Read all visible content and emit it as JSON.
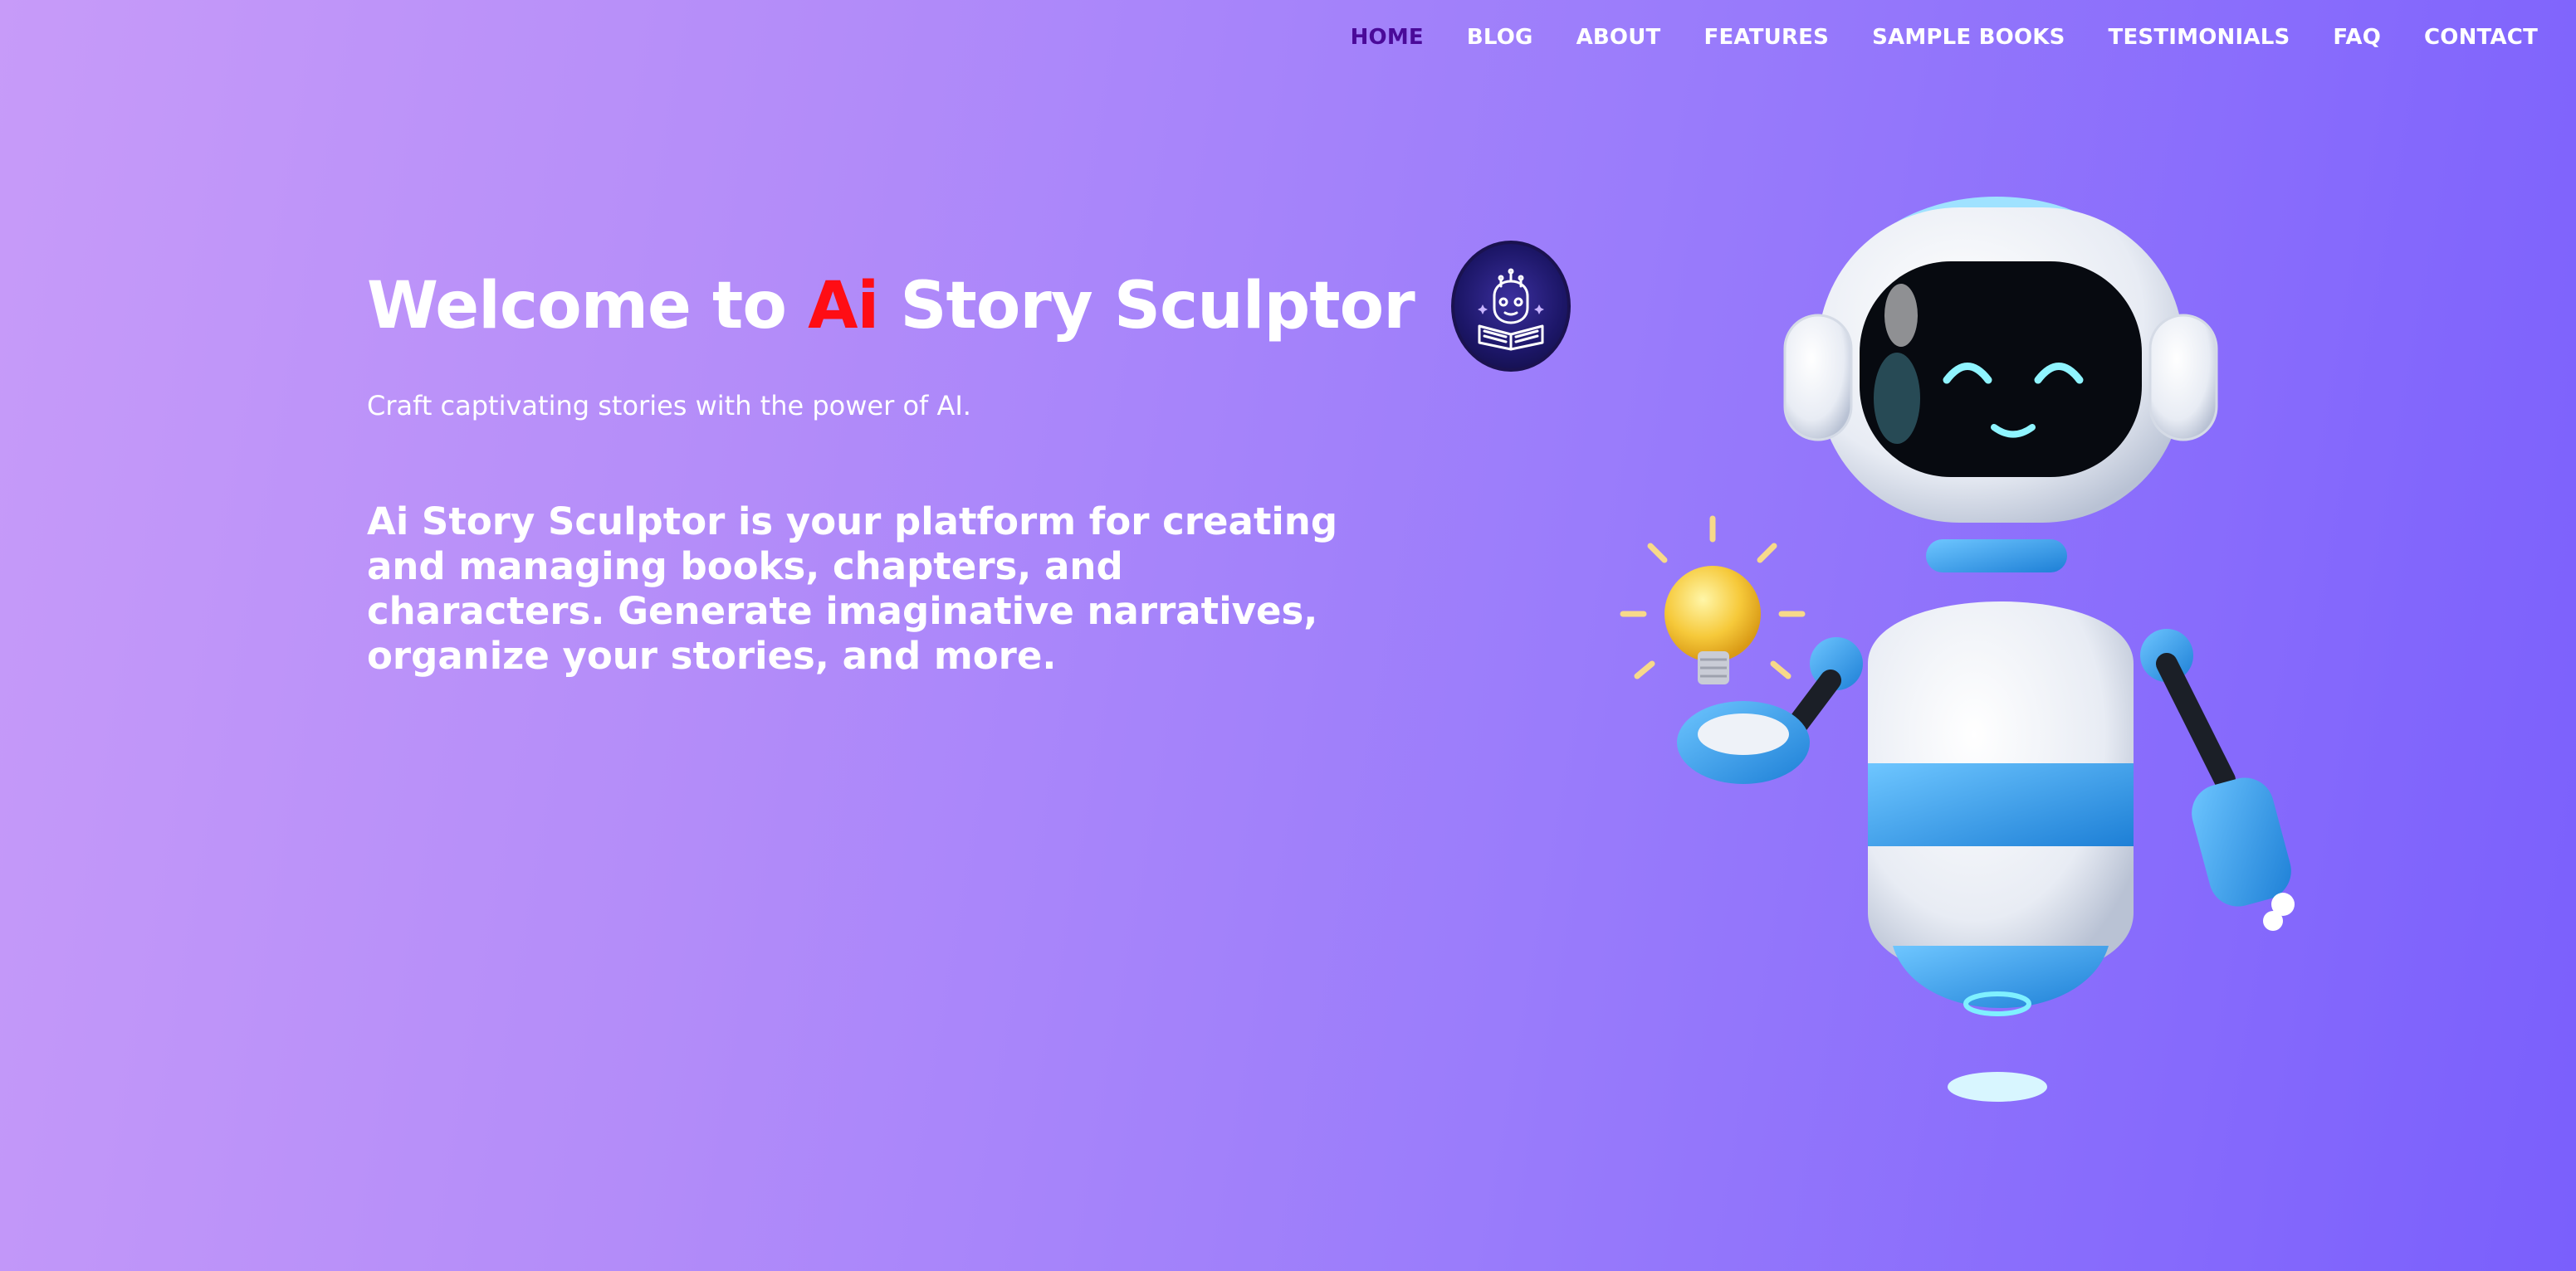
{
  "nav": {
    "items": [
      {
        "label": "HOME",
        "active": true
      },
      {
        "label": "BLOG"
      },
      {
        "label": "ABOUT"
      },
      {
        "label": "FEATURES"
      },
      {
        "label": "SAMPLE BOOKS"
      },
      {
        "label": "TESTIMONIALS"
      },
      {
        "label": "FAQ"
      },
      {
        "label": "CONTACT"
      }
    ]
  },
  "hero": {
    "title_before": "Welcome to ",
    "title_highlight": "Ai",
    "title_after": " Story Sculptor",
    "tagline": "Craft captivating stories with the power of AI.",
    "description": "Ai Story Sculptor is your platform for creating and managing books, chapters, and characters. Generate imaginative narratives, organize your stories, and more."
  },
  "colors": {
    "highlight": "#ff0d14",
    "nav_active": "#4a0a99",
    "gradient_start": "#c79bf9",
    "gradient_end": "#7a5ffc"
  },
  "icons": {
    "logo": "robot-reading-book-logo",
    "illustration": "robot-holding-lightbulb"
  }
}
